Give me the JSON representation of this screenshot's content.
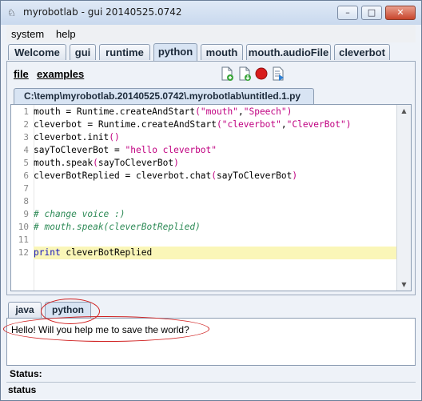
{
  "window": {
    "title": "myrobotlab - gui 20140525.0742",
    "icon": "robot-icon",
    "controls": {
      "minimize": "–",
      "maximize": "□",
      "close": "✕"
    }
  },
  "menubar": {
    "items": [
      "system",
      "help"
    ]
  },
  "tabs": [
    "Welcome",
    "gui",
    "runtime",
    "python",
    "mouth",
    "mouth.audioFile",
    "cleverbot"
  ],
  "active_tab": "python",
  "python_panel": {
    "menus": [
      "file",
      "examples"
    ],
    "toolbar": [
      "new-document-icon",
      "open-document-icon",
      "stop-icon",
      "run-script-icon"
    ],
    "file_tab": "C:\\temp\\myrobotlab.20140525.0742\\.myrobotlab\\untitled.1.py",
    "code": [
      {
        "n": "1",
        "text": "mouth = Runtime.createAndStart(\"mouth\",\"Speech\")"
      },
      {
        "n": "2",
        "text": "cleverbot = Runtime.createAndStart(\"cleverbot\",\"CleverBot\")"
      },
      {
        "n": "3",
        "text": "cleverbot.init()"
      },
      {
        "n": "4",
        "text": "sayToCleverBot = \"hello cleverbot\""
      },
      {
        "n": "5",
        "text": "mouth.speak(sayToCleverBot)"
      },
      {
        "n": "6",
        "text": "cleverBotReplied = cleverbot.chat(sayToCleverBot)"
      },
      {
        "n": "7",
        "text": ""
      },
      {
        "n": "8",
        "text": ""
      },
      {
        "n": "9",
        "text": "# change voice :)"
      },
      {
        "n": "10",
        "text": "# mouth.speak(cleverBotReplied)"
      },
      {
        "n": "11",
        "text": ""
      },
      {
        "n": "12",
        "text": "print cleverBotReplied"
      }
    ],
    "highlighted_line": "12"
  },
  "lower_tabs": [
    "java",
    "python"
  ],
  "lower_active_tab": "python",
  "output_text": "Hello! Will you help me to save the world?",
  "status_label": "Status:",
  "status_bar": "status",
  "colors": {
    "string": "#c00080",
    "comment": "#2e8b57",
    "keyword": "#1010c0",
    "annotation": "#d02020",
    "line_highlight": "#faf6b8"
  }
}
